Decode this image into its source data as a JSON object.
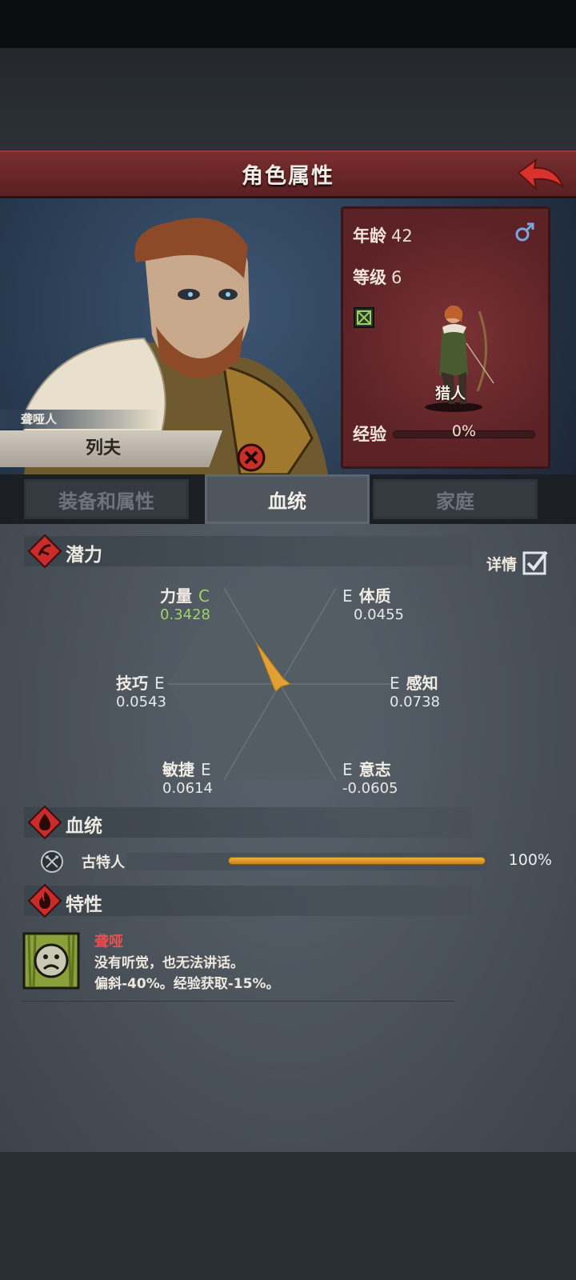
{
  "title": "角色属性",
  "character": {
    "subtitle": "聋哑人",
    "name": "列夫"
  },
  "info": {
    "age_label": "年龄",
    "age_value": "42",
    "level_label": "等级",
    "level_value": "6",
    "class_name": "猎人",
    "exp_label": "经验",
    "exp_percent": "0%",
    "gender_icon": "male-icon"
  },
  "tabs": [
    {
      "label": "装备和属性",
      "active": false
    },
    {
      "label": "血统",
      "active": true
    },
    {
      "label": "家庭",
      "active": false
    }
  ],
  "potential": {
    "heading": "潜力",
    "detail_label": "详情",
    "detail_checked": true,
    "stats": {
      "strength": {
        "name": "力量",
        "grade": "C",
        "value": "0.3428"
      },
      "constitution": {
        "name": "体质",
        "grade": "E",
        "value": "0.0455"
      },
      "skill": {
        "name": "技巧",
        "grade": "E",
        "value": "0.0543"
      },
      "perception": {
        "name": "感知",
        "grade": "E",
        "value": "0.0738"
      },
      "agility": {
        "name": "敏捷",
        "grade": "E",
        "value": "0.0614"
      },
      "will": {
        "name": "意志",
        "grade": "E",
        "value": "-0.0605"
      }
    }
  },
  "bloodline": {
    "heading": "血统",
    "name": "古特人",
    "percent_label": "100%",
    "fill_fraction": 1.0
  },
  "traits": {
    "heading": "特性",
    "items": [
      {
        "name": "聋哑",
        "line1": "没有听觉，也无法讲话。",
        "line2": "偏斜-40%。经验获取-15%。"
      }
    ]
  },
  "colors": {
    "accent_red": "#7a2e2e",
    "grade_c": "#9dd46a",
    "bar_gold": "#f0b13b"
  }
}
